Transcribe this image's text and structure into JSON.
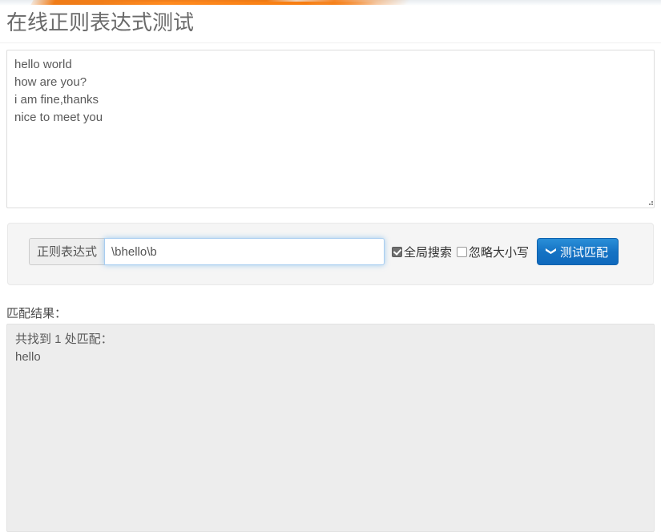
{
  "page": {
    "title": "在线正则表达式测试"
  },
  "decor": {
    "top_banner_color": "#f07c17",
    "accent_color": "#1573c4"
  },
  "source": {
    "name": "source-text",
    "value": "hello world\nhow are you?\ni am fine,thanks\nnice to meet you",
    "placeholder": ""
  },
  "form": {
    "addon_label": "正则表达式",
    "regex": {
      "value": "\\bhello\\b",
      "placeholder": ""
    },
    "options": [
      {
        "label": "全局搜索",
        "checked": true
      },
      {
        "label": "忽略大小写",
        "checked": false
      }
    ],
    "submit": {
      "icon": "chevron-down-icon",
      "glyph": "❯",
      "label": "测试匹配"
    }
  },
  "result": {
    "label": "匹配结果：",
    "summary": "共找到 1 处匹配：",
    "matches": [
      "hello"
    ]
  }
}
